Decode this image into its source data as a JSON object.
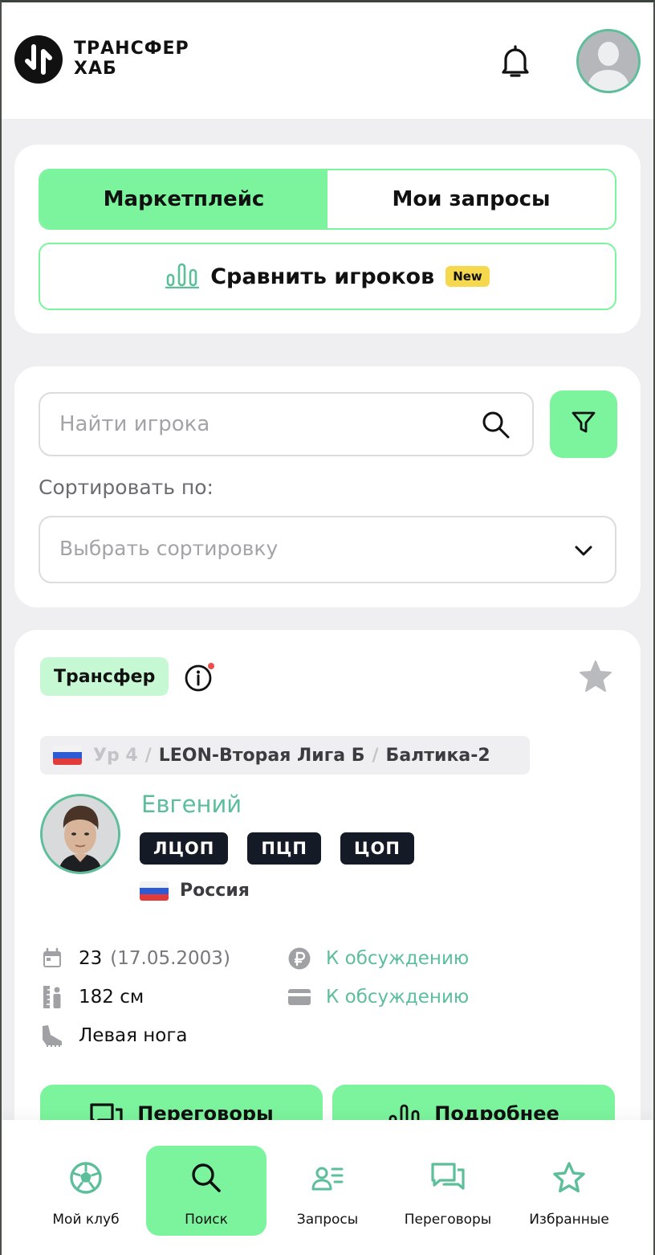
{
  "app": {
    "logo_line1": "ТРАНСФЕР",
    "logo_line2": "ХАБ",
    "brand_color": "#7cf49d",
    "accent_text_color": "#5cbf99"
  },
  "header": {
    "bell_icon": "bell-icon",
    "avatar_icon": "user-avatar"
  },
  "tabs": [
    {
      "label": "Маркетплейс",
      "active": true
    },
    {
      "label": "Мои запросы",
      "active": false
    }
  ],
  "compare": {
    "label": "Сравнить игроков",
    "badge": "New",
    "icon": "bar-chart-icon"
  },
  "search": {
    "placeholder": "Найти игрока",
    "value": ""
  },
  "sort": {
    "label": "Сортировать по:",
    "value": "Выбрать сортировку"
  },
  "player": {
    "deal_type": "Трансфер",
    "level": "Ур 4",
    "league": "LEON-Вторая Лига Б",
    "club": "Балтика-2",
    "name": "Евгений",
    "positions": [
      "ЛЦОП",
      "ПЦП",
      "ЦОП"
    ],
    "country": "Россия",
    "age": "23",
    "birthdate": "(17.05.2003)",
    "height": "182 см",
    "foot": "Левая нога",
    "price": "К обсуждению",
    "salary": "К обсуждению"
  },
  "actions": {
    "negotiate": "Переговоры",
    "details": "Подробнее"
  },
  "nav": [
    {
      "label": "Мой клуб",
      "icon": "football-icon",
      "active": false
    },
    {
      "label": "Поиск",
      "icon": "search-icon",
      "active": true
    },
    {
      "label": "Запросы",
      "icon": "requests-icon",
      "active": false
    },
    {
      "label": "Переговоры",
      "icon": "chat-icon",
      "active": false
    },
    {
      "label": "Избранные",
      "icon": "star-icon",
      "active": false
    }
  ]
}
